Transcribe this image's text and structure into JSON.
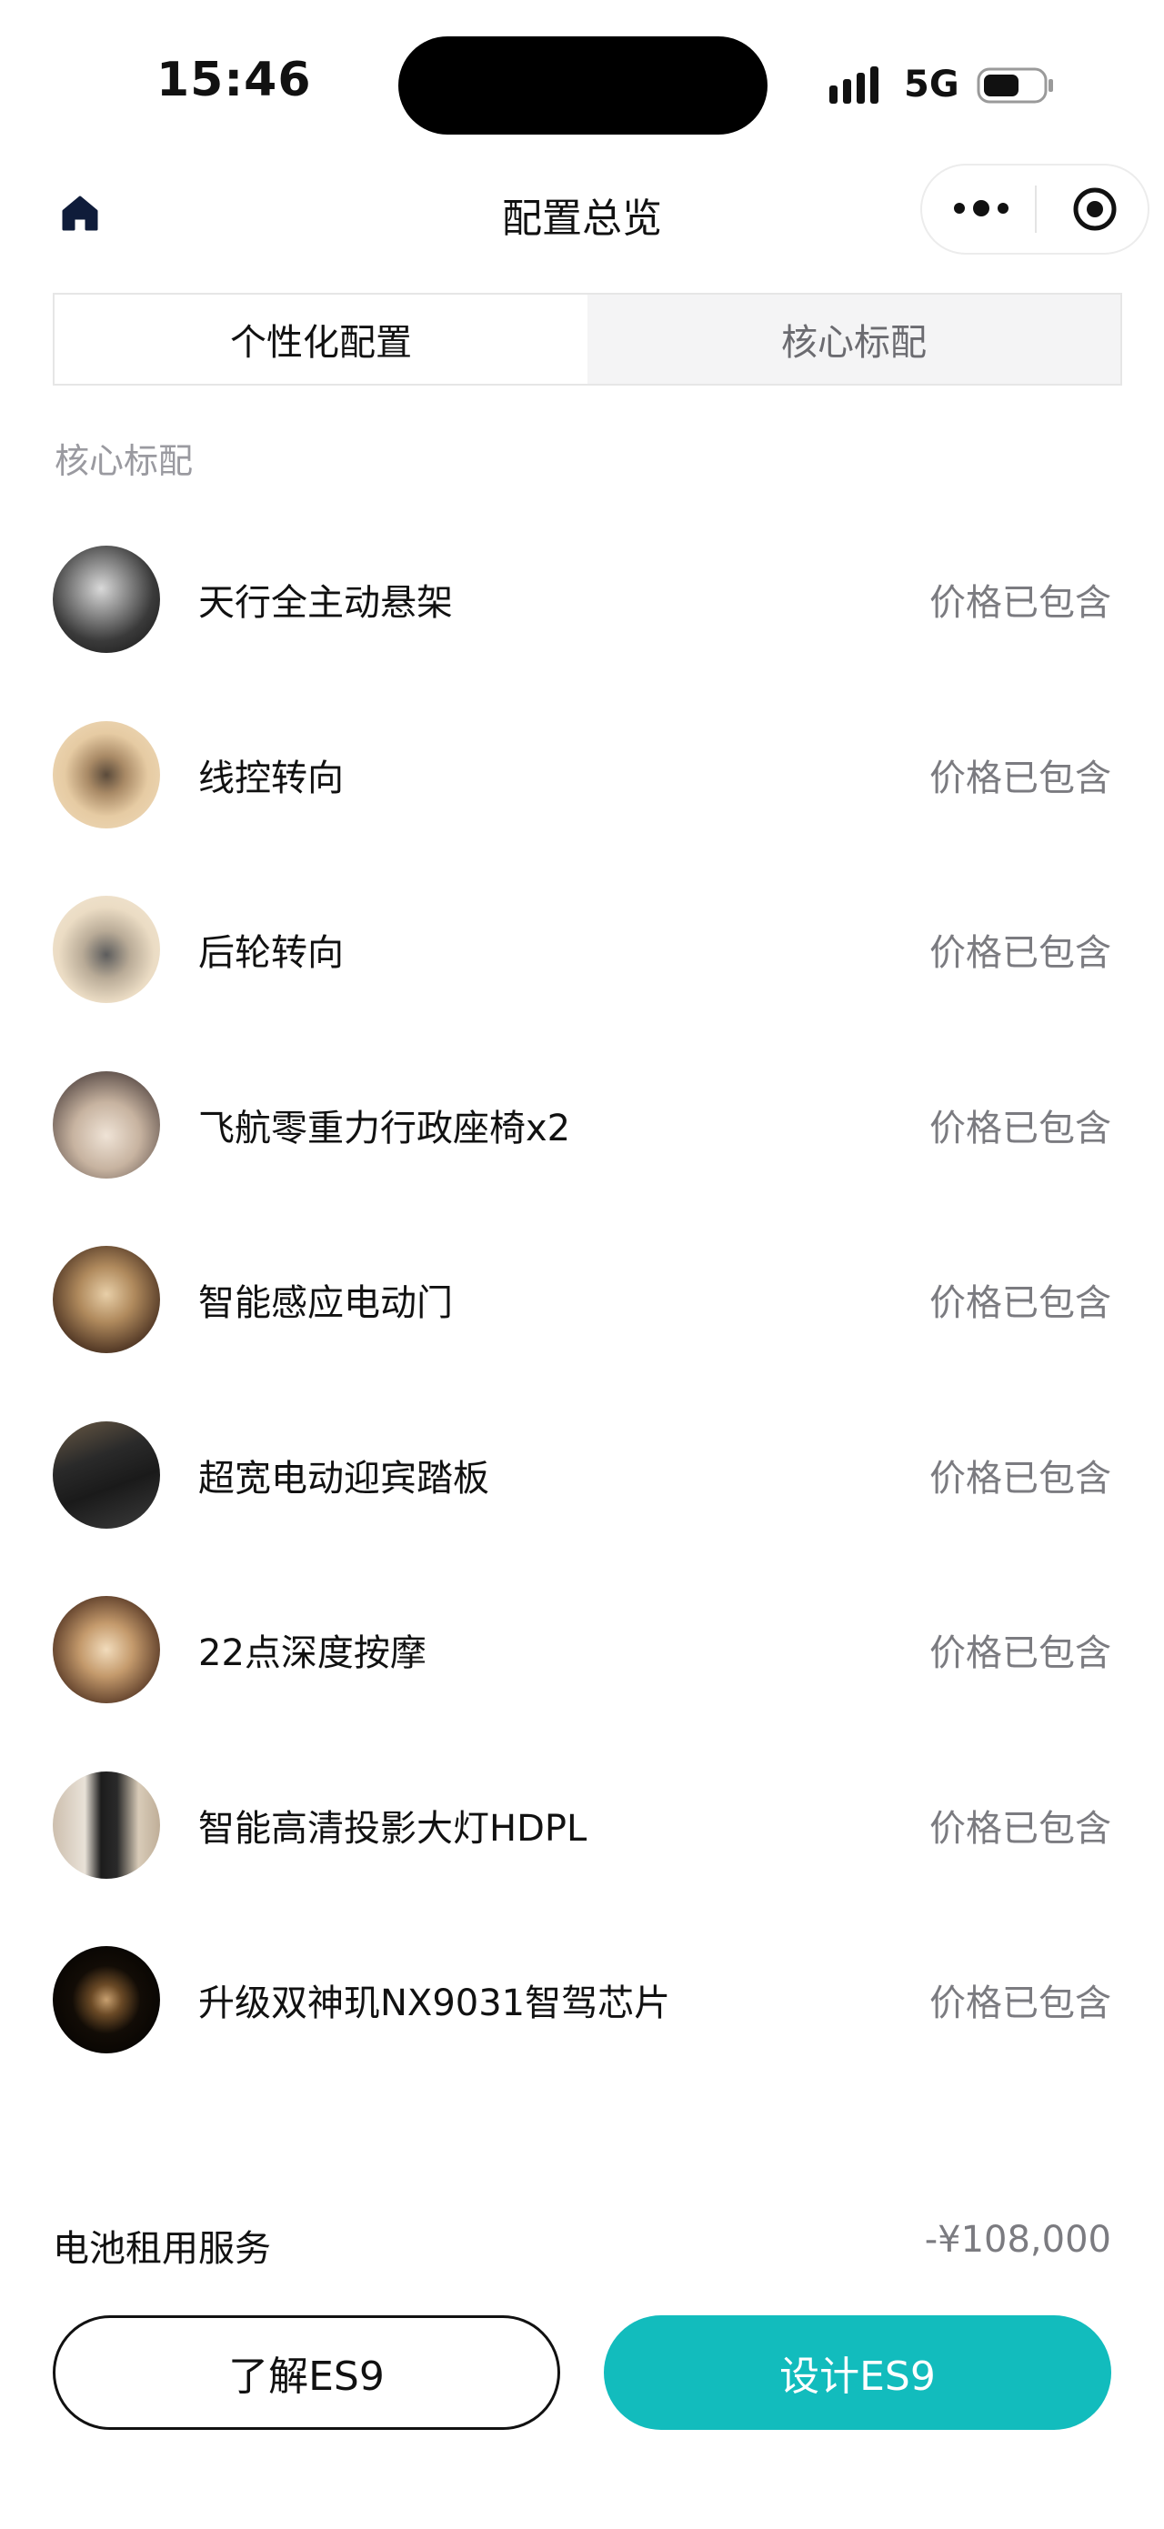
{
  "status_bar": {
    "time": "15:46",
    "network": "5G"
  },
  "nav": {
    "title": "配置总览"
  },
  "tabs": [
    {
      "label": "个性化配置",
      "active": true
    },
    {
      "label": "核心标配",
      "active": false
    }
  ],
  "section_title": "核心标配",
  "items": [
    {
      "name": "天行全主动悬架",
      "status": "价格已包含"
    },
    {
      "name": "线控转向",
      "status": "价格已包含"
    },
    {
      "name": "后轮转向",
      "status": "价格已包含"
    },
    {
      "name": "飞航零重力行政座椅x2",
      "status": "价格已包含"
    },
    {
      "name": "智能感应电动门",
      "status": "价格已包含"
    },
    {
      "name": "超宽电动迎宾踏板",
      "status": "价格已包含"
    },
    {
      "name": "22点深度按摩",
      "status": "价格已包含"
    },
    {
      "name": "智能高清投影大灯HDPL",
      "status": "价格已包含"
    },
    {
      "name": "升级双神玑NX9031智驾芯片",
      "status": "价格已包含"
    }
  ],
  "battery_service": {
    "label": "电池租用服务",
    "price": "-¥108,000"
  },
  "buttons": {
    "learn": "了解ES9",
    "design": "设计ES9"
  },
  "colors": {
    "accent": "#12bcbd",
    "muted_text": "#7b7b80"
  }
}
